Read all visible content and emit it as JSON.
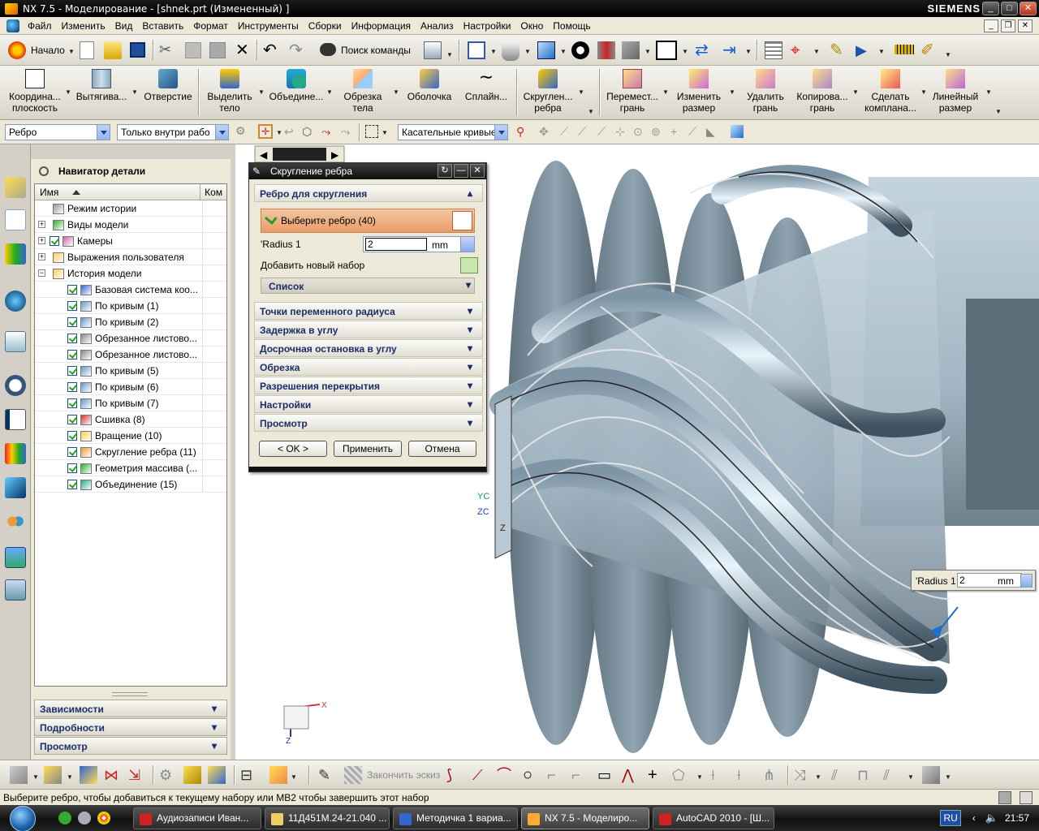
{
  "window": {
    "title": "NX 7.5 - Моделирование - [shnek.prt (Измененный) ]",
    "brand": "SIEMENS"
  },
  "menu": {
    "items": [
      "Файл",
      "Изменить",
      "Вид",
      "Вставить",
      "Формат",
      "Инструменты",
      "Сборки",
      "Информация",
      "Анализ",
      "Настройки",
      "Окно",
      "Помощь"
    ]
  },
  "toolbar_standard": {
    "start_label": "Начало",
    "command_finder_label": "Поиск команды"
  },
  "toolbar_features": {
    "buttons": [
      {
        "line1": "Координа...",
        "line2": "плоскость"
      },
      {
        "line1": "Вытягива...",
        "line2": ""
      },
      {
        "line1": "Отверстие",
        "line2": ""
      },
      {
        "line1": "Выделить",
        "line2": "тело"
      },
      {
        "line1": "Объедине...",
        "line2": ""
      },
      {
        "line1": "Обрезка",
        "line2": "тела"
      },
      {
        "line1": "Оболочка",
        "line2": ""
      },
      {
        "line1": "Сплайн...",
        "line2": ""
      },
      {
        "line1": "Скруглен...",
        "line2": "ребра"
      },
      {
        "line1": "Перемест...",
        "line2": "грань"
      },
      {
        "line1": "Изменить",
        "line2": "размер"
      },
      {
        "line1": "Удалить",
        "line2": "грань"
      },
      {
        "line1": "Копирова...",
        "line2": "грань"
      },
      {
        "line1": "Сделать",
        "line2": "компланa..."
      },
      {
        "line1": "Линейный",
        "line2": "размер"
      }
    ]
  },
  "selection_bar": {
    "type_filter": "Ребро",
    "scope_filter": "Только внутри рабо",
    "curve_rule": "Касательные кривые"
  },
  "part_navigator": {
    "title": "Навигатор детали",
    "col_name": "Имя",
    "col_comment": "Ком",
    "rows": [
      {
        "label": "Режим истории",
        "level": 0,
        "check": false
      },
      {
        "label": "Виды модели",
        "level": 0,
        "check": false
      },
      {
        "label": "Камеры",
        "level": 0,
        "check": true
      },
      {
        "label": "Выражения пользователя",
        "level": 0,
        "check": false
      },
      {
        "label": "История модели",
        "level": 0,
        "check": false
      },
      {
        "label": "Базовая система коо...",
        "level": 1,
        "check": true
      },
      {
        "label": "По кривым (1)",
        "level": 1,
        "check": true
      },
      {
        "label": "По кривым (2)",
        "level": 1,
        "check": true
      },
      {
        "label": "Обрезанное листово...",
        "level": 1,
        "check": true
      },
      {
        "label": "Обрезанное листово...",
        "level": 1,
        "check": true
      },
      {
        "label": "По кривым (5)",
        "level": 1,
        "check": true
      },
      {
        "label": "По кривым (6)",
        "level": 1,
        "check": true
      },
      {
        "label": "По кривым (7)",
        "level": 1,
        "check": true
      },
      {
        "label": "Сшивка (8)",
        "level": 1,
        "check": true
      },
      {
        "label": "Вращение (10)",
        "level": 1,
        "check": true
      },
      {
        "label": "Скругление ребра (11)",
        "level": 1,
        "check": true
      },
      {
        "label": "Геометрия массива (...",
        "level": 1,
        "check": true
      },
      {
        "label": "Объединение (15)",
        "level": 1,
        "check": true
      }
    ],
    "panels": [
      "Зависимости",
      "Подробности",
      "Просмотр"
    ]
  },
  "dialog": {
    "title": "Скругление ребра",
    "group_edge": "Ребро для скругления",
    "select_prompt": "Выберите ребро (40)",
    "radius_label": "'Radius 1",
    "radius_value": "2",
    "radius_unit": "mm",
    "add_set_label": "Добавить новый набор",
    "list_label": "Список",
    "groups": [
      "Точки переменного радиуса",
      "Задержка в углу",
      "Досрочная остановка в углу",
      "Обрезка",
      "Разрешения перекрытия",
      "Настройки",
      "Просмотр"
    ],
    "btn_ok": "< OK >",
    "btn_apply": "Применить",
    "btn_cancel": "Отмена"
  },
  "radius_tooltip": {
    "label": "'Radius 1",
    "value": "2",
    "unit": "mm"
  },
  "bottom_toolbar": {
    "finish_sketch": "Закончить эскиз"
  },
  "status": {
    "message": "Выберите ребро, чтобы добавиться к текущему набору или MB2 чтобы завершить этот набор"
  },
  "taskbar": {
    "items": [
      "Аудиозаписи Иван...",
      "11Д451М.24-21.040 ...",
      "Методичка 1 вариа...",
      "NX 7.5 - Моделиро...",
      "AutoCAD 2010 - [Ш..."
    ],
    "lang": "RU",
    "clock": "21:57"
  },
  "triad_labels": {
    "yc": "YC",
    "zc": "ZC",
    "z": "Z",
    "x": "X"
  },
  "colors": {
    "dialog_select_highlight": "#e99d68",
    "title_bar": "#0e0e0e",
    "model_steel": "#9fb4c2"
  }
}
